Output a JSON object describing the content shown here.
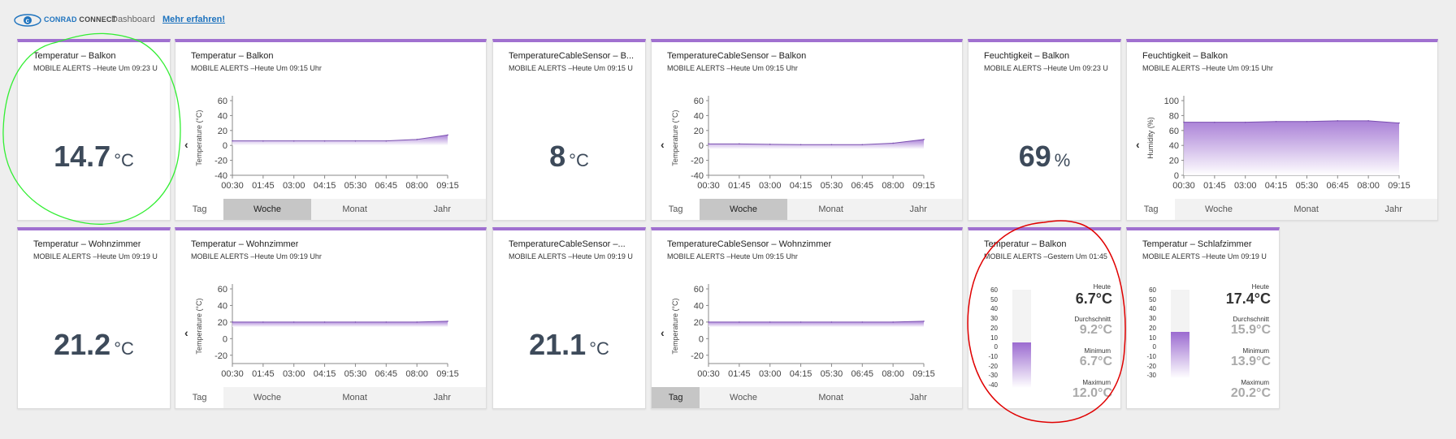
{
  "header": {
    "logo_brand": "CONRAD",
    "logo_suffix": "CONNECT",
    "nav_dashboard": "Dashboard",
    "nav_more": "Mehr erfahren!"
  },
  "tabs": [
    "Tag",
    "Woche",
    "Monat",
    "Jahr"
  ],
  "x_ticks": [
    "00:30",
    "01:45",
    "03:00",
    "04:15",
    "05:30",
    "06:45",
    "08:00",
    "09:15"
  ],
  "cards": {
    "c1": {
      "title": "Temperatur – Balkon",
      "sub": "MOBILE ALERTS –Heute Um 09:23 U",
      "value": "14.7",
      "unit": "°C"
    },
    "c2": {
      "title": "Temperatur – Balkon",
      "sub": "MOBILE ALERTS –Heute Um 09:15 Uhr",
      "ylabel": "Temperature (°C)",
      "y_ticks": [
        "60",
        "40",
        "20",
        "0",
        "-20",
        "-40"
      ]
    },
    "c3": {
      "title": "TemperatureCableSensor – B...",
      "sub": "MOBILE ALERTS –Heute Um 09:15 U",
      "value": "8",
      "unit": "°C"
    },
    "c4": {
      "title": "TemperatureCableSensor – Balkon",
      "sub": "MOBILE ALERTS –Heute Um 09:15 Uhr",
      "ylabel": "Temperature (°C)",
      "y_ticks": [
        "60",
        "40",
        "20",
        "0",
        "-20",
        "-40"
      ]
    },
    "c5": {
      "title": "Feuchtigkeit – Balkon",
      "sub": "MOBILE ALERTS –Heute Um 09:23 U",
      "value": "69",
      "unit": "%"
    },
    "c6": {
      "title": "Feuchtigkeit – Balkon",
      "sub": "MOBILE ALERTS –Heute Um 09:15 Uhr",
      "ylabel": "Humidity (%)",
      "y_ticks": [
        "100",
        "80",
        "60",
        "40",
        "20",
        "0"
      ]
    },
    "c7": {
      "title": "Temperatur – Wohnzimmer",
      "sub": "MOBILE ALERTS –Heute Um 09:19 U",
      "value": "21.2",
      "unit": "°C"
    },
    "c8": {
      "title": "Temperatur – Wohnzimmer",
      "sub": "MOBILE ALERTS –Heute Um 09:19 Uhr",
      "ylabel": "Temperature (°C)",
      "y_ticks": [
        "60",
        "40",
        "20",
        "0",
        "-20"
      ]
    },
    "c9": {
      "title": "TemperatureCableSensor –...",
      "sub": "MOBILE ALERTS –Heute Um 09:19 U",
      "value": "21.1",
      "unit": "°C"
    },
    "c10": {
      "title": "TemperatureCableSensor – Wohnzimmer",
      "sub": "MOBILE ALERTS –Heute Um 09:15 Uhr",
      "ylabel": "Temperature (°C)",
      "y_ticks": [
        "60",
        "40",
        "20",
        "0",
        "-20"
      ]
    },
    "c11": {
      "title": "Temperatur – Balkon",
      "sub": "MOBILE ALERTS –Gestern Um 01:45",
      "scale": [
        "60",
        "50",
        "40",
        "30",
        "20",
        "10",
        "0",
        "-10",
        "-20",
        "-30",
        "-40"
      ],
      "heute_label": "Heute",
      "heute": "6.7°C",
      "avg_label": "Durchschnitt",
      "avg": "9.2°C",
      "min_label": "Minimum",
      "min": "6.7°C",
      "max_label": "Maximum",
      "max": "12.0°C",
      "gauge_level": 0.467
    },
    "c12": {
      "title": "Temperatur – Schlafzimmer",
      "sub": "MOBILE ALERTS –Heute Um 09:19 U",
      "scale": [
        "60",
        "50",
        "40",
        "30",
        "20",
        "10",
        "0",
        "-10",
        "-20",
        "-30"
      ],
      "heute_label": "Heute",
      "heute": "17.4°C",
      "avg_label": "Durchschnitt",
      "avg": "15.9°C",
      "min_label": "Minimum",
      "min": "13.9°C",
      "max_label": "Maximum",
      "max": "20.2°C",
      "gauge_level": 0.524
    }
  },
  "chart_data": [
    {
      "type": "area",
      "title": "Temperatur – Balkon",
      "ylabel": "Temperature (°C)",
      "ylim": [
        -40,
        60
      ],
      "x": [
        "00:30",
        "01:45",
        "03:00",
        "04:15",
        "05:30",
        "06:45",
        "08:00",
        "09:15"
      ],
      "series": [
        {
          "values": [
            6,
            6,
            6,
            6,
            6,
            6,
            8,
            14
          ]
        }
      ],
      "active_tab": "Woche"
    },
    {
      "type": "area",
      "title": "TemperatureCableSensor – Balkon",
      "ylabel": "Temperature (°C)",
      "ylim": [
        -40,
        60
      ],
      "x": [
        "00:30",
        "01:45",
        "03:00",
        "04:15",
        "05:30",
        "06:45",
        "08:00",
        "09:15"
      ],
      "series": [
        {
          "values": [
            2,
            2,
            1.5,
            1,
            1,
            1,
            3,
            8
          ]
        }
      ],
      "active_tab": "Woche"
    },
    {
      "type": "area",
      "title": "Feuchtigkeit – Balkon",
      "ylabel": "Humidity (%)",
      "ylim": [
        0,
        100
      ],
      "x": [
        "00:30",
        "01:45",
        "03:00",
        "04:15",
        "05:30",
        "06:45",
        "08:00",
        "09:15"
      ],
      "series": [
        {
          "values": [
            71,
            71,
            71,
            72,
            72,
            73,
            73,
            70
          ]
        }
      ]
    },
    {
      "type": "area",
      "title": "Temperatur – Wohnzimmer",
      "ylabel": "Temperature (°C)",
      "ylim": [
        -30,
        60
      ],
      "x": [
        "00:30",
        "01:45",
        "03:00",
        "04:15",
        "05:30",
        "06:45",
        "08:00",
        "09:15"
      ],
      "series": [
        {
          "values": [
            20,
            20,
            20,
            20,
            20,
            20,
            20,
            21
          ]
        }
      ]
    },
    {
      "type": "area",
      "title": "TemperatureCableSensor – Wohnzimmer",
      "ylabel": "Temperature (°C)",
      "ylim": [
        -30,
        60
      ],
      "x": [
        "00:30",
        "01:45",
        "03:00",
        "04:15",
        "05:30",
        "06:45",
        "08:00",
        "09:15"
      ],
      "series": [
        {
          "values": [
            20,
            20,
            20,
            20,
            20,
            20,
            20,
            21
          ]
        }
      ],
      "active_tab": "Tag"
    }
  ],
  "colors": {
    "accent": "#a070d0",
    "link": "#1e73be",
    "annotation_green": "#33ee33",
    "annotation_red": "#e00000"
  }
}
